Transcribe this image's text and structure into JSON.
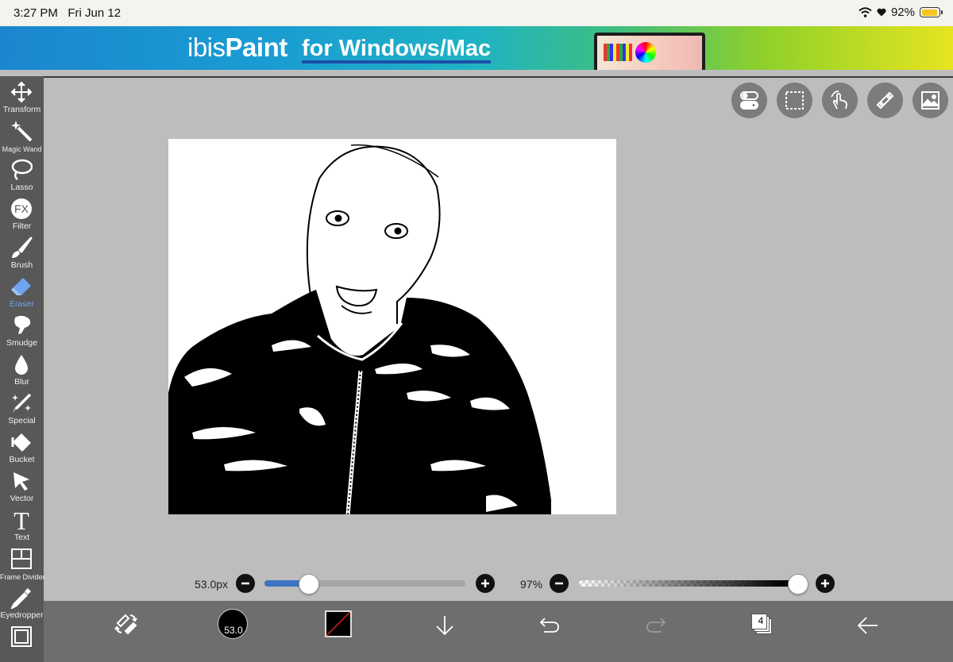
{
  "status_bar": {
    "time": "3:27 PM",
    "date": "Fri Jun 12",
    "battery": "92%",
    "battery_level": 0.92
  },
  "ad_banner": {
    "logo_part1": "ibis",
    "logo_part2": "Paint",
    "tagline": "for Windows/Mac"
  },
  "tools": [
    {
      "label": "Transform",
      "icon": "move-arrows-icon"
    },
    {
      "label": "Magic Wand",
      "icon": "magic-wand-icon"
    },
    {
      "label": "Lasso",
      "icon": "lasso-icon"
    },
    {
      "label": "Filter",
      "icon": "fx-icon",
      "glyph": "FX"
    },
    {
      "label": "Brush",
      "icon": "brush-icon"
    },
    {
      "label": "Eraser",
      "icon": "eraser-icon",
      "active": true
    },
    {
      "label": "Smudge",
      "icon": "smudge-icon"
    },
    {
      "label": "Blur",
      "icon": "drop-icon"
    },
    {
      "label": "Special",
      "icon": "sparkle-pen-icon"
    },
    {
      "label": "Bucket",
      "icon": "bucket-icon"
    },
    {
      "label": "Vector",
      "icon": "cursor-arrow-icon"
    },
    {
      "label": "Text",
      "icon": "text-icon",
      "glyph": "T"
    },
    {
      "label": "Frame Divider",
      "icon": "frame-divider-icon"
    },
    {
      "label": "Eyedropper",
      "icon": "eyedropper-icon"
    },
    {
      "label": "",
      "icon": "canvas-frame-icon"
    }
  ],
  "top_right_buttons": [
    {
      "name": "toggle-icon"
    },
    {
      "name": "selection-icon"
    },
    {
      "name": "hand-icon"
    },
    {
      "name": "ruler-icon"
    },
    {
      "name": "reference-image-icon"
    }
  ],
  "brush_size": {
    "value_label": "53.0px",
    "fraction": 0.22
  },
  "opacity": {
    "value_label": "97%",
    "fraction": 0.97
  },
  "bottom_bar": {
    "brush_size_label": "53.0",
    "layers_count": "4",
    "color": "#000000"
  }
}
